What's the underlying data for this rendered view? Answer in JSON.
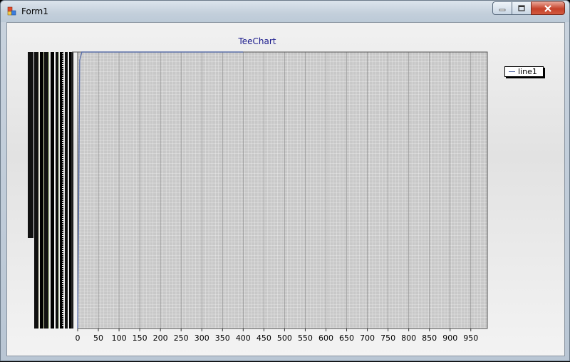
{
  "window": {
    "title": "Form1"
  },
  "titlebar_buttons": {
    "minimize": "minimize-icon",
    "maximize": "maximize-icon",
    "close": "close-icon"
  },
  "colors": {
    "line": "#5b6fa8",
    "grid": "#9a9a9a",
    "title": "#1a1a8c",
    "panel": "#c8c8c8"
  },
  "chart_data": {
    "type": "line",
    "title": "TeeChart",
    "x_ticks": [
      "0",
      "50",
      "100",
      "150",
      "200",
      "250",
      "300",
      "350",
      "400",
      "450",
      "500",
      "550",
      "600",
      "650",
      "700",
      "750",
      "800",
      "850",
      "900",
      "950"
    ],
    "xlim": [
      0,
      990
    ],
    "grid": true,
    "legend_position": "top-right",
    "series": [
      {
        "name": "line1",
        "x": [
          0,
          5,
          10,
          70,
          400
        ],
        "y_rel": [
          0.0,
          0.97,
          1.0,
          1.0,
          1.0
        ]
      }
    ]
  }
}
